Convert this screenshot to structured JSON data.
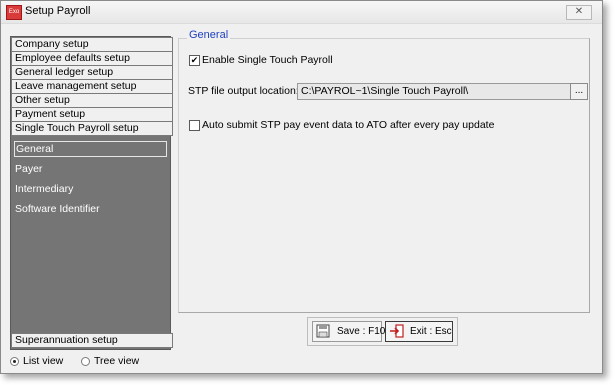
{
  "window": {
    "app_icon": "Exo",
    "title": "Setup Payroll",
    "close_glyph": "✕"
  },
  "nav": {
    "items": [
      "Company setup",
      "Employee defaults setup",
      "General ledger setup",
      "Leave management setup",
      "Other setup",
      "Payment setup",
      "Single Touch Payroll setup"
    ],
    "sub_items": [
      "General",
      "Payer",
      "Intermediary",
      "Software Identifier"
    ],
    "selected_sub_item": "General",
    "bottom_item": "Superannuation setup"
  },
  "view_mode": {
    "list_label": "List view",
    "tree_label": "Tree view",
    "selected": "List view"
  },
  "panel": {
    "title": "General",
    "enable_stp_label": "Enable Single Touch Payroll",
    "enable_stp_checked": true,
    "check_glyph": "✔",
    "file_location_label": "STP file output location:",
    "file_location_value": "C:\\PAYROL~1\\Single Touch Payroll\\",
    "browse_label": "...",
    "auto_submit_label": "Auto submit STP pay event data to ATO after every pay update",
    "auto_submit_checked": false
  },
  "buttons": {
    "save_label": "Save : F10",
    "exit_label": "Exit : Esc"
  },
  "icons": {
    "save": "save-disk-icon",
    "exit": "exit-door-icon"
  },
  "colors": {
    "nav_background": "#757575",
    "panel_title": "#1f3fbf",
    "exit_accent": "#c21e1e"
  }
}
